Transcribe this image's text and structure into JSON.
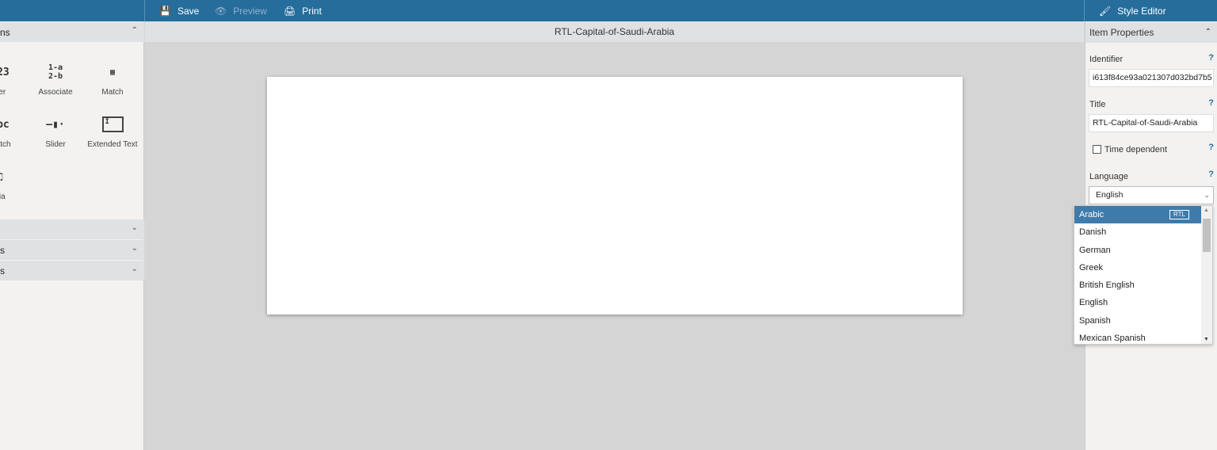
{
  "toolbar": {
    "save": "Save",
    "preview": "Preview",
    "print": "Print",
    "style_editor": "Style Editor"
  },
  "left": {
    "section_title": "ns",
    "tools": [
      {
        "label": "der",
        "icon": "order-icon"
      },
      {
        "label": "Associate",
        "icon": "associate-icon"
      },
      {
        "label": "Match",
        "icon": "match-icon"
      },
      {
        "label": "Match",
        "icon": "gap-match-icon"
      },
      {
        "label": "Slider",
        "icon": "slider-icon"
      },
      {
        "label": "Extended Text",
        "icon": "extended-text-icon"
      },
      {
        "label": "dia",
        "icon": "media-icon"
      }
    ],
    "collapsed_sections": [
      "",
      "s",
      "s"
    ]
  },
  "center": {
    "title": "RTL-Capital-of-Saudi-Arabia"
  },
  "properties": {
    "header": "Item Properties",
    "identifier_label": "Identifier",
    "identifier": "i613f84ce93a021307d032bd7b5",
    "title_label": "Title",
    "title": "RTL-Capital-of-Saudi-Arabia",
    "time_dependent_label": "Time dependent",
    "time_dependent": false,
    "language_label": "Language",
    "language": "English",
    "help": "?"
  },
  "language_options": [
    {
      "label": "Arabic",
      "badge": "RTL",
      "selected": true
    },
    {
      "label": "Danish"
    },
    {
      "label": "German"
    },
    {
      "label": "Greek"
    },
    {
      "label": "British English"
    },
    {
      "label": "English"
    },
    {
      "label": "Spanish"
    },
    {
      "label": "Mexican Spanish"
    }
  ],
  "colors": {
    "topbar": "#266d9c",
    "selected_option": "#3e7bab"
  }
}
